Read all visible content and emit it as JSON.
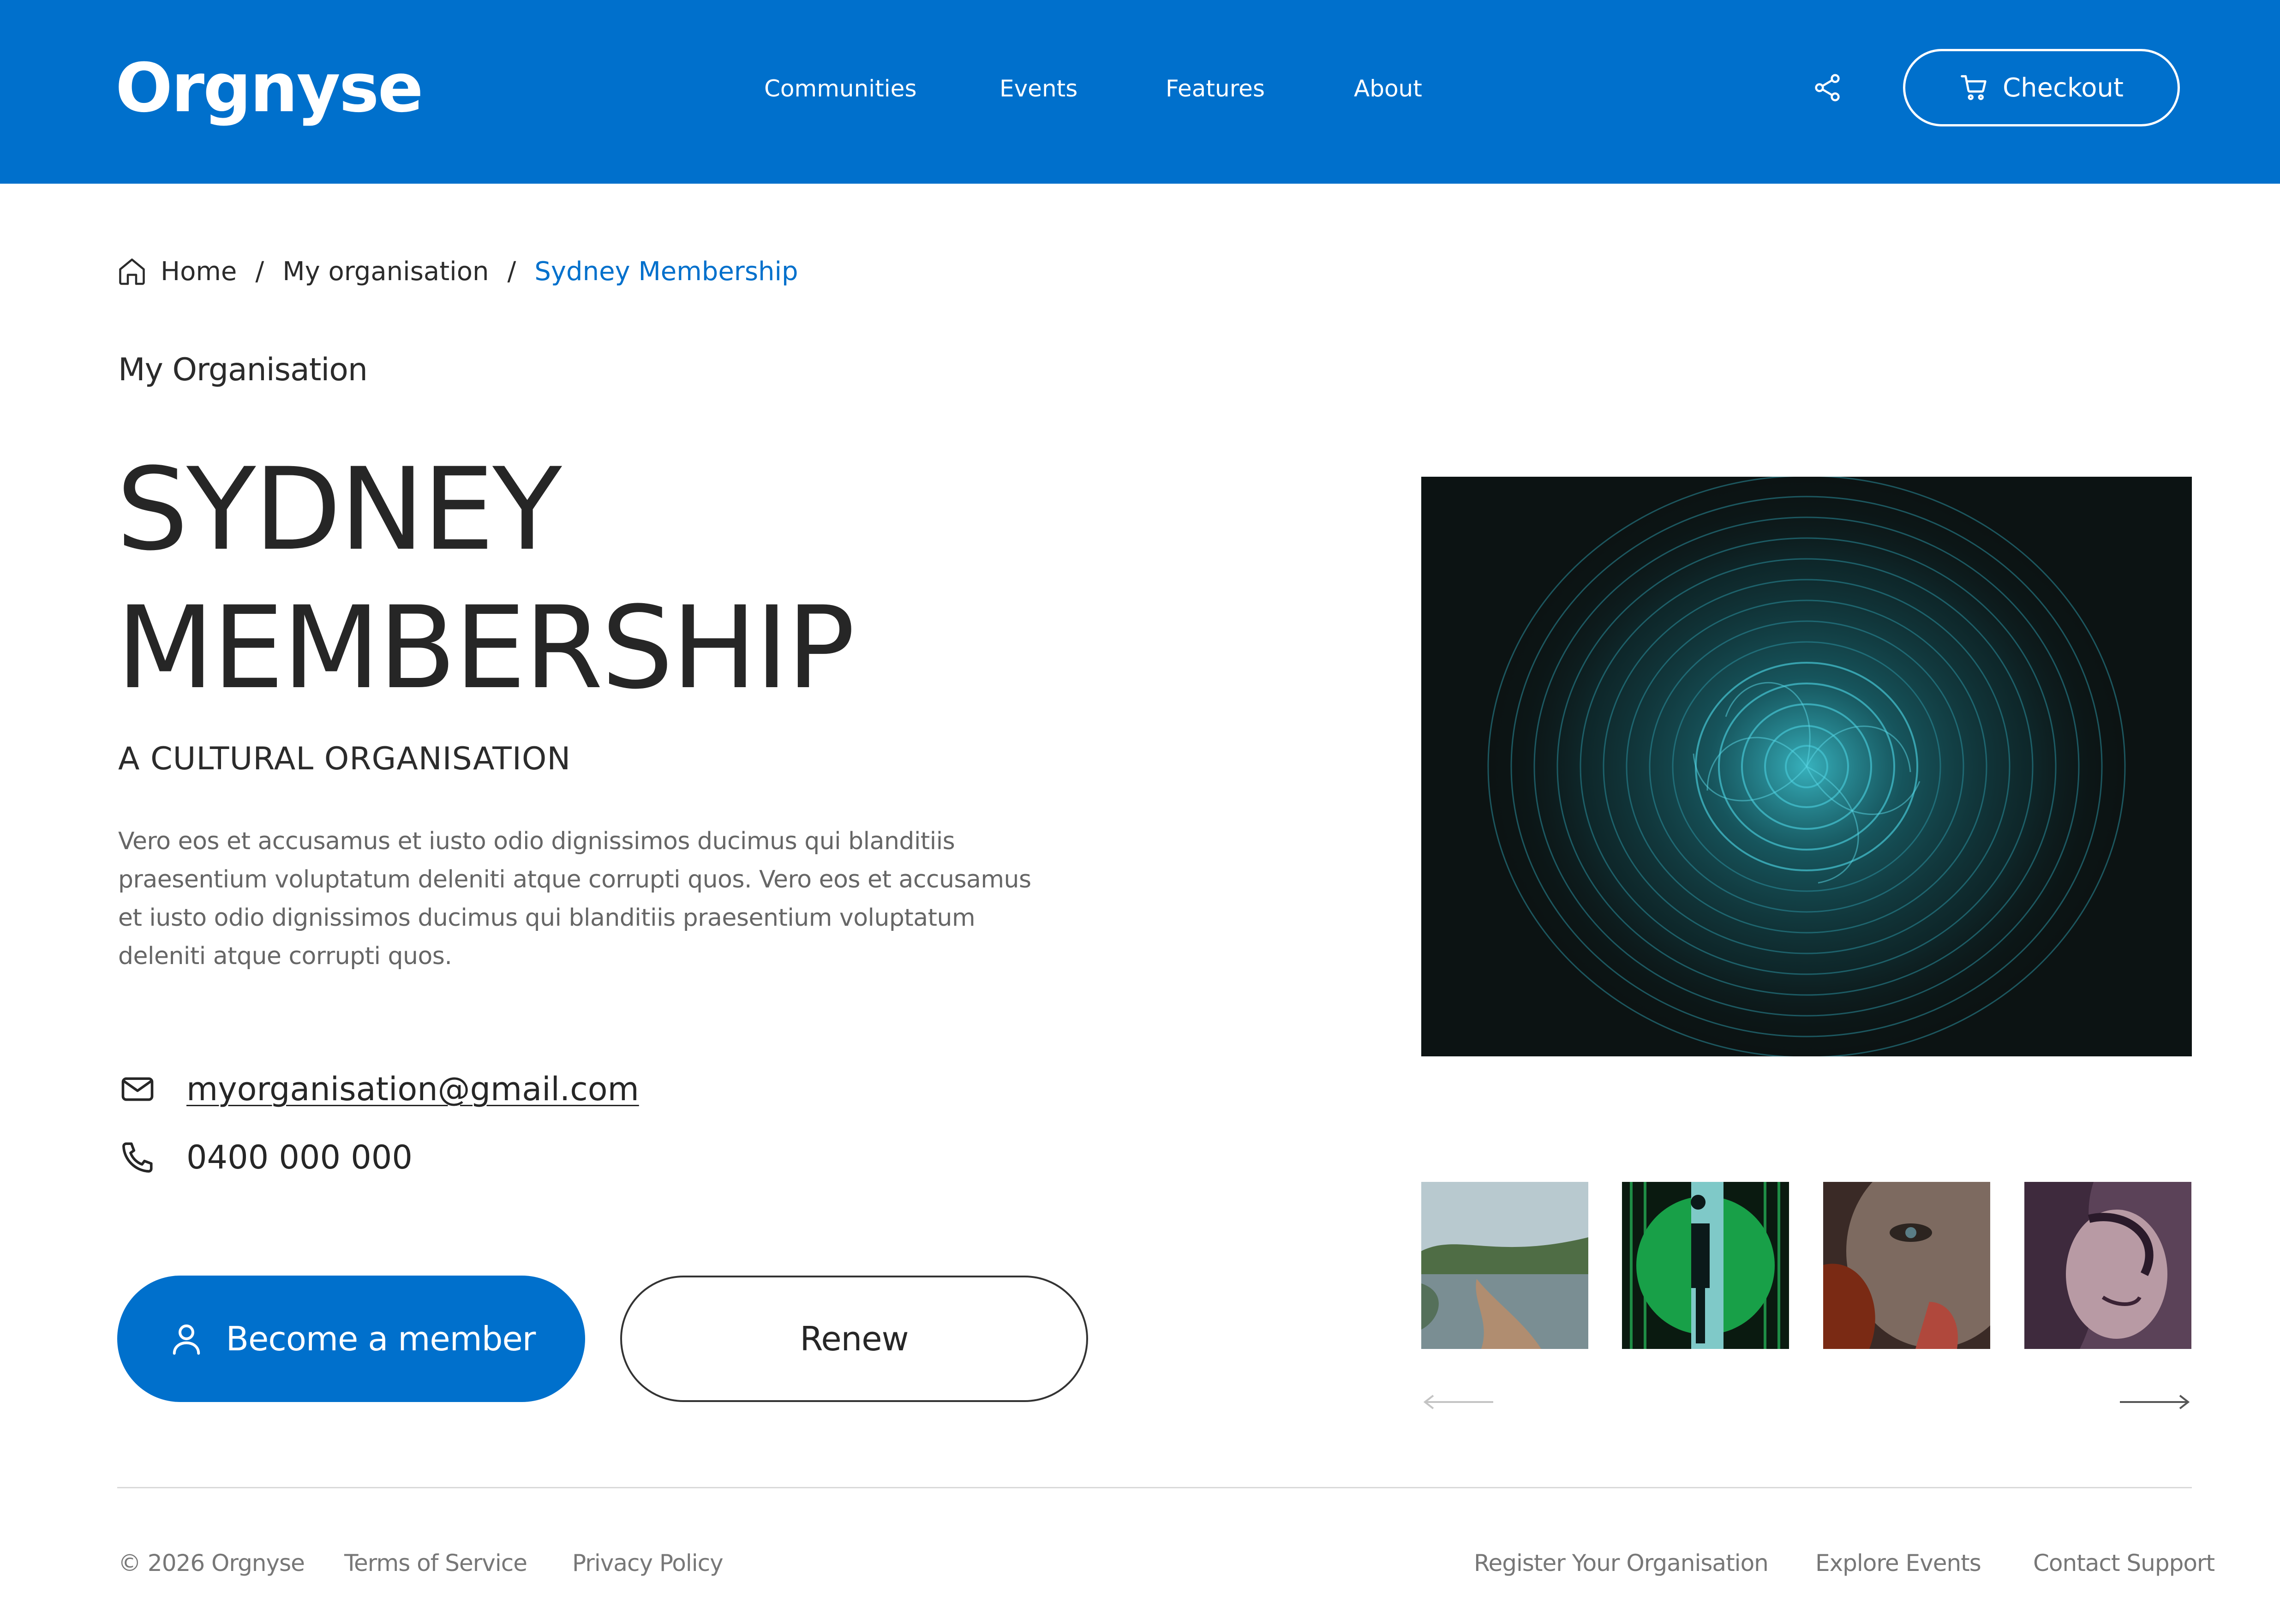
{
  "header": {
    "logo": "Orgnyse",
    "nav": [
      "Communities",
      "Events",
      "Features",
      "About"
    ],
    "share_icon": "share-icon",
    "checkout_label": "Checkout",
    "colors": {
      "background": "#0070cc",
      "text": "#ffffff"
    }
  },
  "breadcrumb": {
    "home_icon": "home-icon",
    "items": [
      "Home",
      "My organisation",
      "Sydney Membership"
    ],
    "separator": "/"
  },
  "main": {
    "org_name": "My Organisation",
    "title_line1": "SYDNEY",
    "title_line2": "MEMBERSHIP",
    "subtitle": "A CULTURAL ORGANISATION",
    "description": "Vero eos et accusamus et iusto odio dignissimos ducimus qui blanditiis praesentium voluptatum deleniti atque corrupti quos. Vero eos et accusamus et iusto odio dignissimos ducimus qui blanditiis praesentium voluptatum deleniti atque corrupti quos.",
    "email": "myorganisation@gmail.com",
    "phone": "0400 000 000",
    "primary_button": "Become a member",
    "secondary_button": "Renew"
  },
  "gallery": {
    "main_image": "abstract teal spiral artwork",
    "thumbnails": [
      "watercolor lake landscape",
      "silhouette in green doorway",
      "close-up face portrait",
      "purple abstract portrait"
    ],
    "prev_icon": "arrow-left-icon",
    "next_icon": "arrow-right-icon"
  },
  "footer": {
    "copyright": "© 2026 Orgnyse",
    "left_links": [
      "Terms of Service",
      "Privacy Policy"
    ],
    "right_links": [
      "Register Your Organisation",
      "Explore Events",
      "Contact Support"
    ]
  },
  "colors": {
    "accent": "#0070cc",
    "text": "#262626",
    "muted": "#666666"
  }
}
